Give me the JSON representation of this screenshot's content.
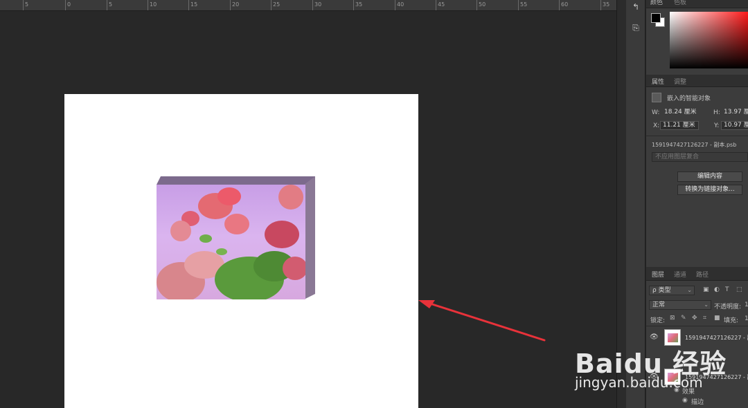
{
  "ruler": {
    "labels": [
      "5",
      "0",
      "5",
      "10",
      "15",
      "20",
      "25",
      "30",
      "35",
      "40",
      "45",
      "50",
      "55",
      "60",
      "35"
    ]
  },
  "panels": {
    "color_tabs": [
      "颜色",
      "色板"
    ],
    "properties_tabs": [
      "属性",
      "调整"
    ],
    "smart_object_label": "嵌入的智能对象",
    "w_label": "W:",
    "w_value": "18.24 厘米",
    "h_label": "H:",
    "h_value": "13.97 厘米",
    "x_label": "X:",
    "x_value": "11.21 厘米",
    "y_label": "Y:",
    "y_value": "10.97 厘米",
    "file_name": "1591947427126227 - 副本.psb",
    "layer_comp_placeholder": "不应用图层复合",
    "edit_contents_button": "编辑内容",
    "convert_linked_button": "转换为链接对象...",
    "layers_tabs": [
      "图层",
      "通道",
      "路径"
    ],
    "filter_kind": "ρ 类型",
    "blend_mode": "正常",
    "opacity_label": "不透明度:",
    "opacity_value": "1",
    "lock_label": "锁定:",
    "fill_label": "填充:",
    "fill_value": "1",
    "layers": [
      {
        "name": "1591947427126227 - 副"
      },
      {
        "name": "1591947427126227 - 副"
      }
    ],
    "effects_label": "效果",
    "stroke_label": "描边"
  },
  "watermark": {
    "brand": "Baidu 经验",
    "url": "jingyan.baidu.com"
  },
  "colors": {
    "workspace": "#282828",
    "canvas": "#ffffff",
    "arrow": "#e8323a",
    "panel": "#3c3c3c"
  }
}
